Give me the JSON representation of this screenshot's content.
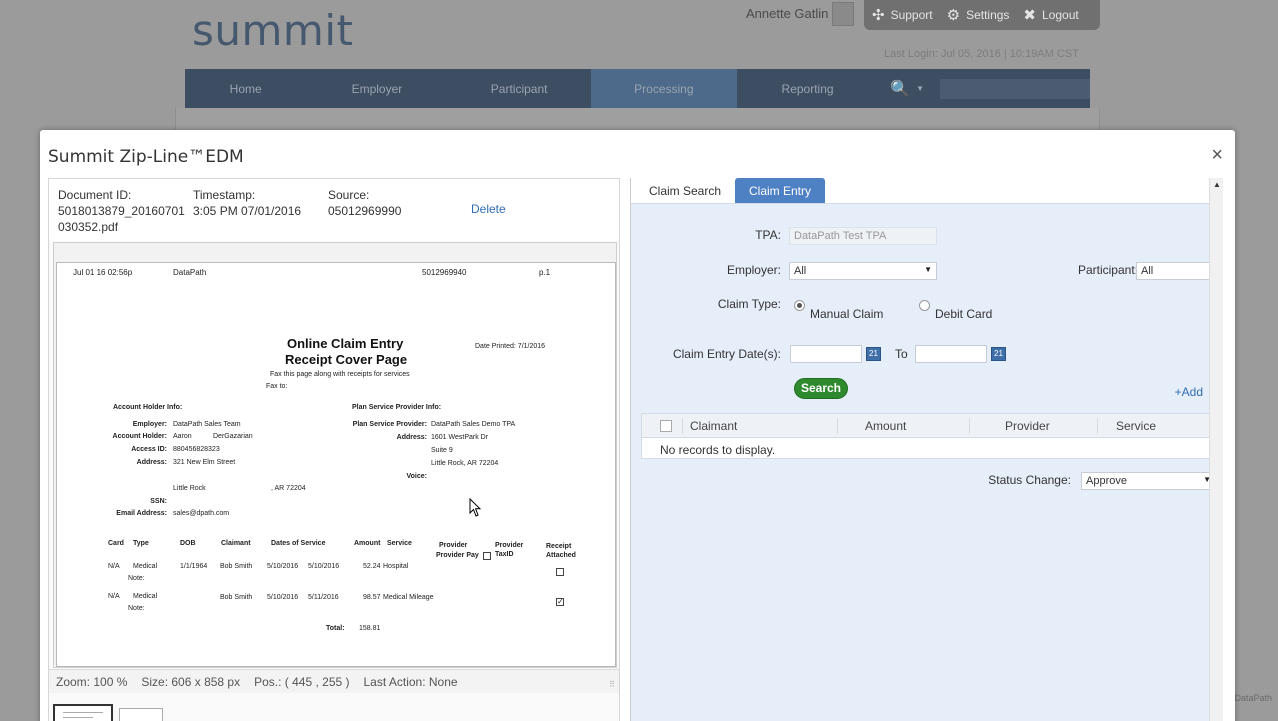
{
  "background": {
    "logo": "summit",
    "user_name": "Annette Gatlin",
    "topbar": {
      "support": "Support",
      "settings": "Settings",
      "logout": "Logout"
    },
    "last_login": "Last Login: Jul 05, 2016 | 10:19AM CST",
    "nav": {
      "items": [
        "Home",
        "Employer",
        "Participant",
        "Processing",
        "Reporting"
      ],
      "active": "Processing"
    },
    "watermark": "DataPath"
  },
  "modal": {
    "title": "Summit Zip-Line™EDM",
    "close": "×"
  },
  "document": {
    "id_label": "Document ID:",
    "id_value_1": "5018013879_20160701",
    "id_value_2": "030352.pdf",
    "timestamp_label": "Timestamp:",
    "timestamp_value": "3:05 PM 07/01/2016",
    "source_label": "Source:",
    "source_value": "05012969990",
    "delete_label": "Delete"
  },
  "fax_page": {
    "header_date": "Jul 01 16 02:56p",
    "header_from": "DataPath",
    "header_number": "5012969940",
    "header_page": "p.1",
    "title_1": "Online Claim Entry",
    "title_2": "Receipt Cover Page",
    "date_printed": "Date Printed: 7/1/2016",
    "instruction": "Fax this page along with receipts for services",
    "fax_to": "Fax to:",
    "account_holder_info": "Account Holder Info:",
    "employer_label": "Employer:",
    "employer_value": "DataPath Sales Team",
    "account_holder_label": "Account Holder:",
    "account_holder_first": "Aaron",
    "account_holder_last": "DerGazarian",
    "access_id_label": "Access ID:",
    "access_id_value": "880456828323",
    "address_label": "Address:",
    "address_value": "321 New Elm Street",
    "city_value": "Little Rock",
    "state_zip_value": ", AR  72204",
    "ssn_label": "SSN:",
    "email_label": "Email Address:",
    "email_value": "sales@dpath.com",
    "provider_info": "Plan Service Provider Info:",
    "provider_label": "Plan Service Provider:",
    "provider_value": "DataPath Sales Demo TPA",
    "provider_address_label": "Address:",
    "provider_address_1": "1601 WestPark Dr",
    "provider_address_2": "Suite 9",
    "provider_address_3": "Little Rock, AR  72204",
    "voice_label": "Voice:",
    "table_headers": [
      "Card",
      "Type",
      "DOB",
      "Claimant",
      "Dates of Service",
      "Amount",
      "Service",
      "Provider",
      "Provider Pay",
      "Provider",
      "TaxID",
      "Receipt",
      "Attached"
    ],
    "row1": {
      "card": "N/A",
      "type": "Medical",
      "note": "Note:",
      "dob": "1/1/1964",
      "claimant": "Bob Smith",
      "from": "5/10/2016",
      "to": "5/10/2016",
      "amount": "52.24",
      "service": "Hospital"
    },
    "row2": {
      "card": "N/A",
      "type": "Medical",
      "note": "Note:",
      "claimant": "Bob Smith",
      "from": "5/10/2016",
      "to": "5/11/2016",
      "amount": "98.57",
      "service": "Medical Mileage"
    },
    "total_label": "Total:",
    "total_value": "158.81"
  },
  "status_bar": {
    "zoom": "Zoom:  100 %",
    "size": "Size:  606 x 858 px",
    "pos": "Pos.: ( 445 , 255 )",
    "last_action": "Last Action:  None"
  },
  "right_pane": {
    "tabs": [
      "Claim Search",
      "Claim Entry"
    ],
    "active_tab": "Claim Entry",
    "tpa_label": "TPA:",
    "tpa_value": "DataPath Test TPA",
    "employer_label": "Employer:",
    "employer_value": "All",
    "participant_label": "Participant:",
    "participant_value": "All",
    "claim_type_label": "Claim Type:",
    "claim_type_options": [
      "Manual Claim",
      "Debit Card"
    ],
    "claim_type_selected": "Manual Claim",
    "entry_date_label": "Claim Entry Date(s):",
    "to_label": "To",
    "search_button": "Search",
    "add_link": "+Add",
    "grid_columns": [
      "Claimant",
      "Amount",
      "Provider",
      "Service"
    ],
    "grid_empty": "No records to display.",
    "status_change_label": "Status Change:",
    "status_change_value": "Approve"
  },
  "colors": {
    "tab_active": "#4e80c4",
    "search_button": "#2f8a2f",
    "link": "#2f6db5",
    "right_pane_bg": "#e6eef9"
  }
}
